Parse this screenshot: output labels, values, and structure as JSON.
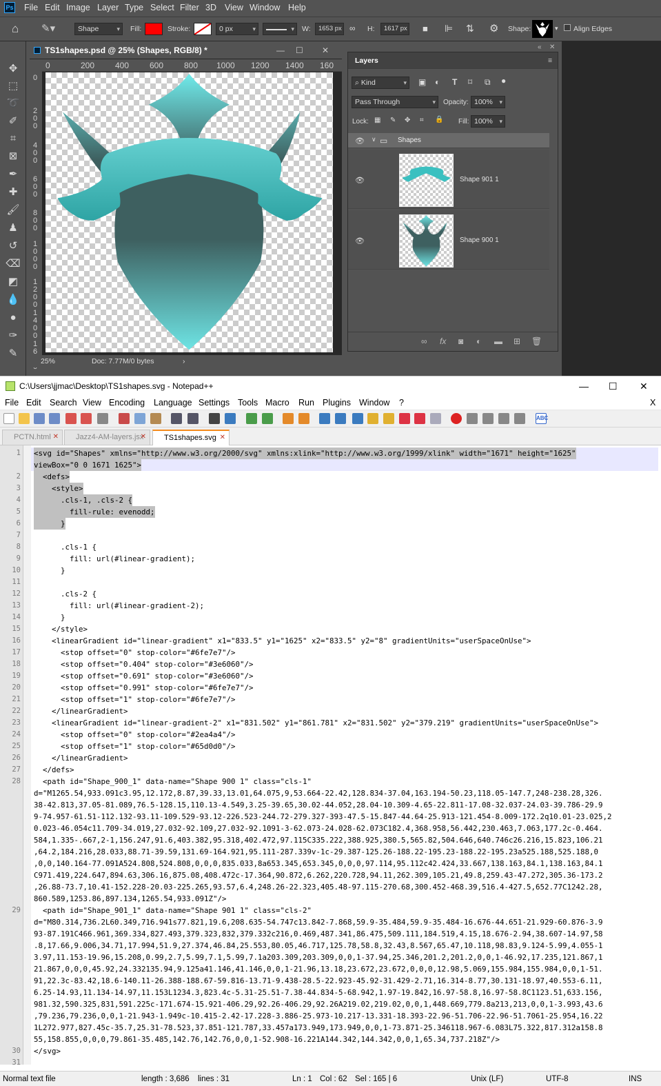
{
  "photoshop": {
    "logo": "Ps",
    "menu": [
      "File",
      "Edit",
      "Image",
      "Layer",
      "Type",
      "Select",
      "Filter",
      "3D",
      "View",
      "Window",
      "Help"
    ],
    "options": {
      "tool_mode": "Shape",
      "fill_label": "Fill:",
      "fill_color": "#ff0000",
      "stroke_label": "Stroke:",
      "stroke_width": "0 px",
      "w_label": "W:",
      "w_value": "1653 px",
      "h_label": "H:",
      "h_value": "1617 px",
      "shape_label": "Shape:",
      "align_edges": "Align Edges"
    },
    "document": {
      "title": "TS1shapes.psd @ 25% (Shapes, RGB/8) *",
      "ruler_h": [
        "0",
        "200",
        "400",
        "600",
        "800",
        "1000",
        "1200",
        "1400",
        "160"
      ],
      "ruler_v": [
        "0",
        "200",
        "400",
        "600",
        "800",
        "1000",
        "1200",
        "1400",
        "1600"
      ],
      "zoom": "25%",
      "doc_info": "Doc: 7.77M/0 bytes"
    },
    "layers_panel": {
      "title": "Layers",
      "kind": "Kind",
      "blend_mode": "Pass Through",
      "opacity_label": "Opacity:",
      "opacity": "100%",
      "lock_label": "Lock:",
      "fill_label": "Fill:",
      "fill": "100%",
      "group_name": "Shapes",
      "layers": [
        {
          "name": "Shape 901 1"
        },
        {
          "name": "Shape 900 1"
        }
      ]
    },
    "colors": {
      "teal_dark": "#3e6060",
      "teal_light": "#6fe7e7",
      "ribbon_dark": "#2ea4a4",
      "ribbon_light": "#65d0d0"
    }
  },
  "notepad": {
    "title": "C:\\Users\\jjmac\\Desktop\\TS1shapes.svg - Notepad++",
    "menu": [
      "File",
      "Edit",
      "Search",
      "View",
      "Encoding",
      "Language",
      "Settings",
      "Tools",
      "Macro",
      "Run",
      "Plugins",
      "Window",
      "?"
    ],
    "tabs": [
      "PCTN.html",
      "Jazz4-AM-layers.jsx",
      "TS1shapes.svg"
    ],
    "lines": [
      {
        "n": "1",
        "text": "<svg id=\"Shapes\" xmlns=\"http://www.w3.org/2000/svg\" xmlns:xlink=\"http://www.w3.org/1999/xlink\" width=\"1671\" height=\"1625\""
      },
      {
        "n": "",
        "text": "viewBox=\"0 0 1671 1625\">"
      },
      {
        "n": "2",
        "text": "  <defs>"
      },
      {
        "n": "3",
        "text": "    <style>"
      },
      {
        "n": "4",
        "text": "      .cls-1, .cls-2 {"
      },
      {
        "n": "5",
        "text": "        fill-rule: evenodd;"
      },
      {
        "n": "6",
        "text": "      }"
      },
      {
        "n": "7",
        "text": ""
      },
      {
        "n": "8",
        "text": "      .cls-1 {"
      },
      {
        "n": "9",
        "text": "        fill: url(#linear-gradient);"
      },
      {
        "n": "10",
        "text": "      }"
      },
      {
        "n": "11",
        "text": ""
      },
      {
        "n": "12",
        "text": "      .cls-2 {"
      },
      {
        "n": "13",
        "text": "        fill: url(#linear-gradient-2);"
      },
      {
        "n": "14",
        "text": "      }"
      },
      {
        "n": "15",
        "text": "    </style>"
      },
      {
        "n": "16",
        "text": "    <linearGradient id=\"linear-gradient\" x1=\"833.5\" y1=\"1625\" x2=\"833.5\" y2=\"8\" gradientUnits=\"userSpaceOnUse\">"
      },
      {
        "n": "17",
        "text": "      <stop offset=\"0\" stop-color=\"#6fe7e7\"/>"
      },
      {
        "n": "18",
        "text": "      <stop offset=\"0.404\" stop-color=\"#3e6060\"/>"
      },
      {
        "n": "19",
        "text": "      <stop offset=\"0.691\" stop-color=\"#3e6060\"/>"
      },
      {
        "n": "20",
        "text": "      <stop offset=\"0.991\" stop-color=\"#6fe7e7\"/>"
      },
      {
        "n": "21",
        "text": "      <stop offset=\"1\" stop-color=\"#6fe7e7\"/>"
      },
      {
        "n": "22",
        "text": "    </linearGradient>"
      },
      {
        "n": "23",
        "text": "    <linearGradient id=\"linear-gradient-2\" x1=\"831.502\" y1=\"861.781\" x2=\"831.502\" y2=\"379.219\" gradientUnits=\"userSpaceOnUse\">"
      },
      {
        "n": "24",
        "text": "      <stop offset=\"0\" stop-color=\"#2ea4a4\"/>"
      },
      {
        "n": "25",
        "text": "      <stop offset=\"1\" stop-color=\"#65d0d0\"/>"
      },
      {
        "n": "26",
        "text": "    </linearGradient>"
      },
      {
        "n": "27",
        "text": "  </defs>"
      },
      {
        "n": "28",
        "text": "  <path id=\"Shape_900_1\" data-name=\"Shape 900 1\" class=\"cls-1\""
      },
      {
        "n": "",
        "text": "d=\"M1265.54,933.091c3.95,12.172,8.87,39.33,13.01,64.075,9,53.664-22.42,128.834-37.04,163.194-50.23,118.05-147.7,248-238.28,326."
      },
      {
        "n": "",
        "text": "38-42.813,37.05-81.089,76.5-128.15,110.13-4.549,3.25-39.65,30.02-44.052,28.04-10.309-4.65-22.811-17.08-32.037-24.03-39.786-29.9"
      },
      {
        "n": "",
        "text": "9-74.957-61.51-112.132-93.11-109.529-93.12-226.523-244.72-279.327-393-47.5-15.847-44.64-25.913-121.454-8.009-172.2q10.01-23.025,2"
      },
      {
        "n": "",
        "text": "0.023-46.054c11.709-34.019,27.032-92.109,27.032-92.1091-3-62.073-24.028-62.073C182.4,368.958,56.442,230.463,7.063,177.2c-0.464."
      },
      {
        "n": "",
        "text": "584,1.335-.667,2-1,156.247,91.6,403.382,95.318,402.472,97.115C335.222,388.925,380.5,565.82,504.646,640.746c26.216,15.823,106.21"
      },
      {
        "n": "",
        "text": ",64.2,184.216,28.033,88.71-39.59,131.69-164.921,95.111-287.339v-1c-29.387-125.26-188.22-195.23-188.22-195.23a525.188,525.188,0"
      },
      {
        "n": "",
        "text": ",0,0,140.164-77.091A524.808,524.808,0,0,0,835.033,8a653.345,653.345,0,0,0,97.114,95.112c42.424,33.667,138.163,84.1,138.163,84.1"
      },
      {
        "n": "",
        "text": "C971.419,224.647,894.63,306.16,875.08,408.472c-17.364,90.872,6.262,220.728,94.11,262.309,105.21,49.8,259.43-47.272,305.36-173.2"
      },
      {
        "n": "",
        "text": ",26.88-73.7,10.41-152.228-20.03-225.265,93.57,6.4,248.26-22.323,405.48-97.115-270.68,300.452-468.39,516.4-427.5,652.77C1242.28,"
      },
      {
        "n": "",
        "text": "860.589,1253.86,897.134,1265.54,933.091Z\"/>"
      },
      {
        "n": "29",
        "text": "  <path id=\"Shape_901_1\" data-name=\"Shape 901 1\" class=\"cls-2\""
      },
      {
        "n": "",
        "text": "d=\"M80.314,736.2L60.349,716.941s77.821,19.6,208.635-54.747c13.842-7.868,59.9-35.484,59.9-35.484-16.676-44.651-21.929-60.876-3.9"
      },
      {
        "n": "",
        "text": "93-87.191C466.961,369.334,827.493,379.323,832,379.332c216,0.469,487.341,86.475,509.111,184.519,4.15,18.676-2.94,38.607-14.97,58"
      },
      {
        "n": "",
        "text": ".8,17.66,9.006,34.71,17.994,51.9,27.374,46.84,25.553,80.05,46.717,125.78,58.8,32.43,8.567,65.47,10.118,98.83,9.124-5.99,4.055-1"
      },
      {
        "n": "",
        "text": "3.97,11.153-19.96,15.208,0.99,2.7,5.99,7.1,5.99,7.1a203.309,203.309,0,0,1-37.94,25.346,201.2,201.2,0,0,1-46.92,17.235,121.867,1"
      },
      {
        "n": "",
        "text": "21.867,0,0,0,45.92,24.332135.94,9.125a41.146,41.146,0,0,1-21.96,13.18,23.672,23.672,0,0,0,12.98,5.069,155.984,155.984,0,0,1-51."
      },
      {
        "n": "",
        "text": "91,22.3c-83.42,18.6-140.11-26.388-188.67-59.816-13.71-9.438-28.5-22.923-45.92-31.429-2.71,16.314-8.77,30.131-18.97,40.553-6.11,"
      },
      {
        "n": "",
        "text": "6.25-14.93,11.134-14.97,11.153L1234.3,823.4c-5.31-25.51-7.38-44.834-5-68.942,1.97-19.842,16.97-58.8,16.97-58.8C1123.51,633.156,"
      },
      {
        "n": "",
        "text": "981.32,590.325,831,591.225c-171.674-15.921-406.29,92.26-406.29,92.26A219.02,219.02,0,0,1,448.669,779.8a213,213,0,0,1-3.993,43.6"
      },
      {
        "n": "",
        "text": ",79.236,79.236,0,0,1-21.943-1.949c-10.415-2.42-17.228-3.886-25.973-10.217-13.331-18.393-22.96-51.706-22.96-51.7061-25.954,16.22"
      },
      {
        "n": "",
        "text": "1L272.977,827.45c-35.7,25.31-78.523,37.851-121.787,33.457a173.949,173.949,0,0,1-73.871-25.346118.967-6.083L75.322,817.312a158.8"
      },
      {
        "n": "",
        "text": "55,158.855,0,0,0,79.861-35.485,142.76,142.76,0,0,1-52.908-16.221A144.342,144.342,0,0,1,65.34,737.218Z\"/>"
      },
      {
        "n": "30",
        "text": "</svg>"
      },
      {
        "n": "31",
        "text": ""
      }
    ],
    "status": {
      "type": "Normal text file",
      "length": "length : 3,686",
      "lines": "lines : 31",
      "ln": "Ln : 1",
      "col": "Col : 62",
      "sel": "Sel : 165 | 6",
      "eol": "Unix (LF)",
      "encoding": "UTF-8",
      "ins": "INS"
    }
  }
}
